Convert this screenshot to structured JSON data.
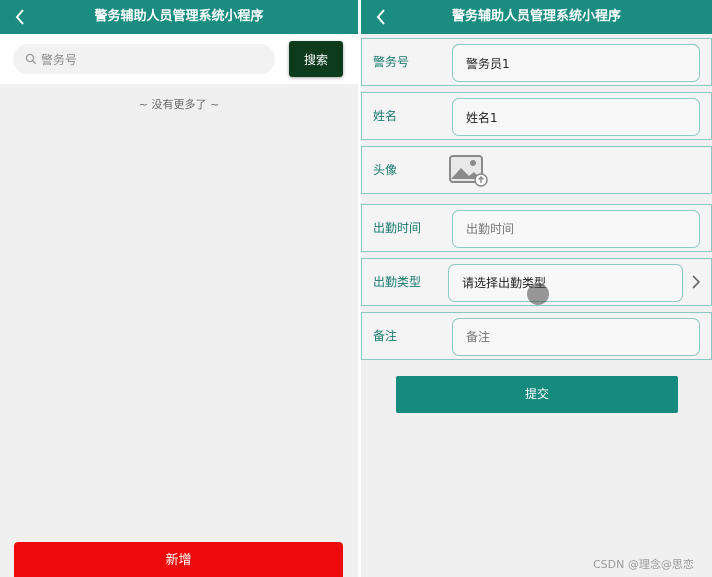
{
  "left": {
    "nav": {
      "title": "警务辅助人员管理系统小程序"
    },
    "search": {
      "placeholder": "警务号",
      "button": "搜索"
    },
    "list": {
      "empty_text": "~ 没有更多了 ~"
    },
    "add_button": "新增"
  },
  "right": {
    "nav": {
      "title": "警务辅助人员管理系统小程序"
    },
    "form": {
      "police_no": {
        "label": "警务号",
        "value": "警务员1"
      },
      "name": {
        "label": "姓名",
        "value": "姓名1"
      },
      "avatar": {
        "label": "头像",
        "icon": "image-upload-icon"
      },
      "attendance_time": {
        "label": "出勤时间",
        "placeholder": "出勤时间"
      },
      "attendance_type": {
        "label": "出勤类型",
        "value": "请选择出勤类型"
      },
      "remark": {
        "label": "备注",
        "placeholder": "备注"
      }
    },
    "submit_button": "提交",
    "watermark": "CSDN @理念@思恋"
  },
  "colors": {
    "nav_bg": "#1a8c80",
    "search_button": "#0d3c1c",
    "add_button": "#ee0a0a",
    "submit_button": "#178a7e",
    "row_border": "#8cc9c0",
    "label_text": "#1a7a6e"
  }
}
